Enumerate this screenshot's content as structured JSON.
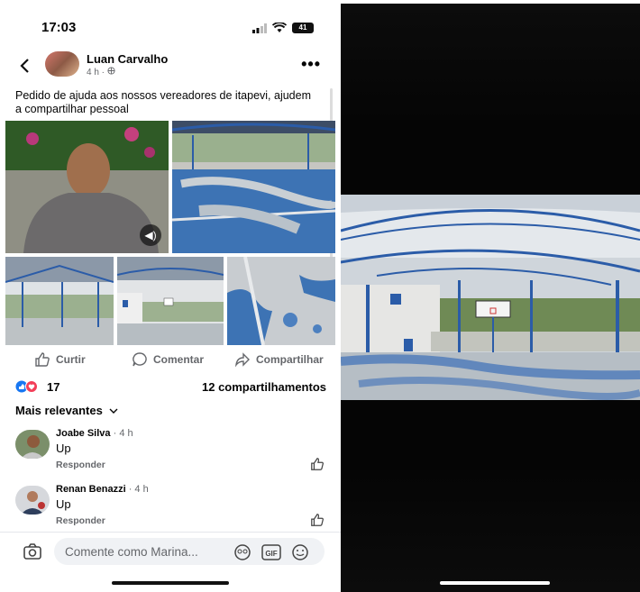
{
  "status_bar": {
    "time": "17:03",
    "battery": "41"
  },
  "post": {
    "author": "Luan Carvalho",
    "meta": "4 h · ",
    "text": "Pedido de ajuda aos nossos vereadores de itapevi, ajudem a compartilhar pessoal"
  },
  "actions": {
    "like": "Curtir",
    "comment": "Comentar",
    "share": "Compartilhar"
  },
  "reactions": {
    "count": "17",
    "shares": "12 compartilhamentos"
  },
  "sort_label": "Mais relevantes",
  "comments": [
    {
      "name": "Joabe Silva",
      "time": " · 4 h",
      "text": "Up",
      "reply": "Responder"
    },
    {
      "name": "Renan Benazzi",
      "time": " · 4 h",
      "text": "Up",
      "reply": "Responder"
    }
  ],
  "composer": {
    "placeholder": "Comente como Marina..."
  },
  "icons": [
    "back-icon",
    "more-icon",
    "sound-icon",
    "like-icon",
    "comment-icon",
    "share-icon",
    "camera-icon",
    "avatar-sticker-icon",
    "gif-icon",
    "emoji-icon"
  ],
  "colors": {
    "fb_blue": "#1877f2",
    "love_red": "#f33e58",
    "court_blue": "#3d6fb8"
  }
}
